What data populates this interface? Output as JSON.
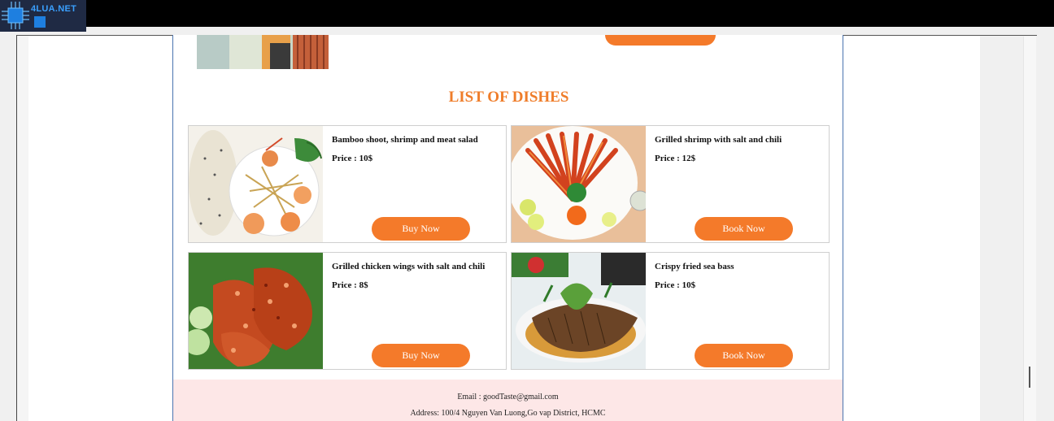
{
  "brand": {
    "logo_text": "4LUA.NET"
  },
  "section": {
    "title": "LIST OF DISHES"
  },
  "dishes": [
    {
      "name": "Bamboo shoot, shrimp and meat salad",
      "price": "Price : 10$",
      "button": "Buy Now"
    },
    {
      "name": "Grilled shrimp with salt and chili",
      "price": "Price : 12$",
      "button": "Book Now"
    },
    {
      "name": "Grilled chicken wings with salt and chili",
      "price": "Price : 8$",
      "button": "Buy Now"
    },
    {
      "name": "Crispy fried sea bass",
      "price": "Price : 10$",
      "button": "Book Now"
    }
  ],
  "footer": {
    "email": "Email : goodTaste@gmail.com",
    "address": "Address: 100/4 Nguyen Van Luong,Go vap District, HCMC"
  },
  "colors": {
    "accent": "#f47a2a",
    "title": "#ef7d2a",
    "footer_bg": "#fde7e7",
    "page_border": "#4a74b0"
  }
}
